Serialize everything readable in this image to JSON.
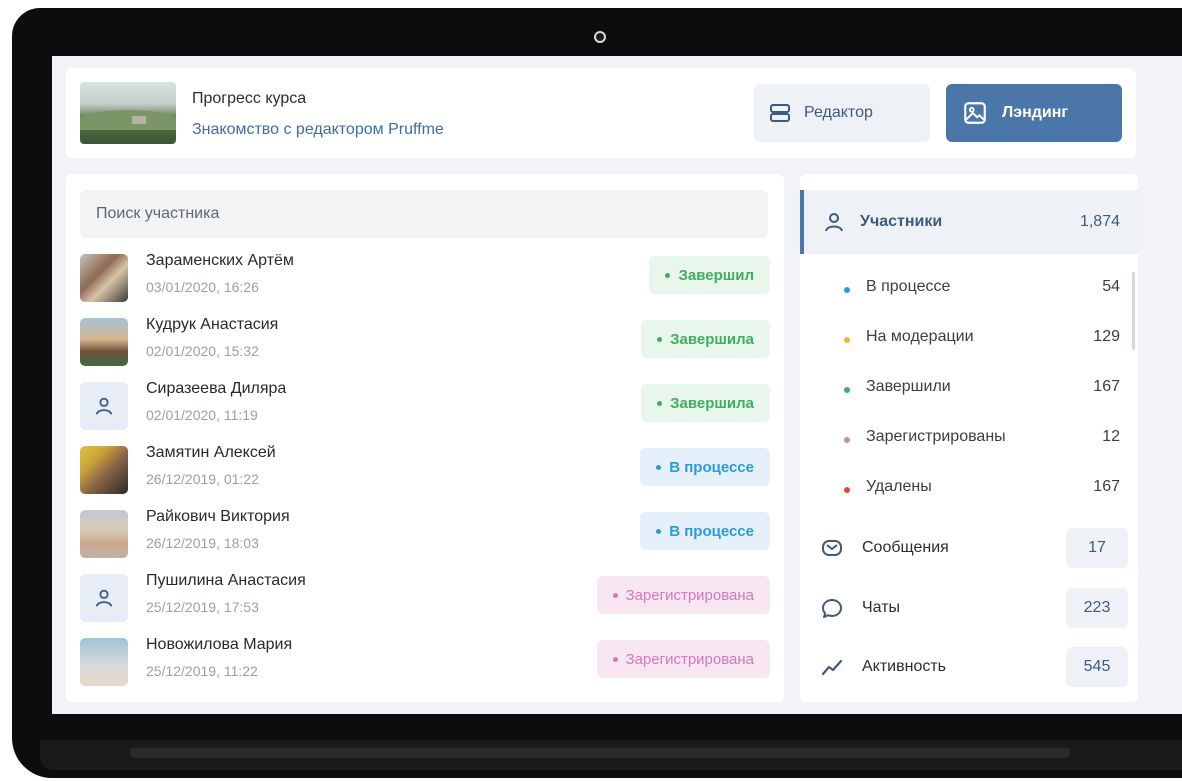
{
  "header": {
    "label": "Прогресс курса",
    "course_name": "Знакомство с редактором Pruffme",
    "editor_button": "Редактор",
    "landing_button": "Лэндинг"
  },
  "search": {
    "placeholder": "Поиск участника"
  },
  "participants_list": [
    {
      "name": "Зараменских Артём",
      "date": "03/01/2020, 16:26",
      "status": "Завершил",
      "status_type": "done",
      "avatar": "photo"
    },
    {
      "name": "Кудрук Анастасия",
      "date": "02/01/2020, 15:32",
      "status": "Завершила",
      "status_type": "done",
      "avatar": "photo"
    },
    {
      "name": "Сиразеева Диляра",
      "date": "02/01/2020, 11:19",
      "status": "Завершила",
      "status_type": "done",
      "avatar": "user-icon"
    },
    {
      "name": "Замятин Алексей",
      "date": "26/12/2019, 01:22",
      "status": "В процессе",
      "status_type": "process",
      "avatar": "photo"
    },
    {
      "name": "Райкович Виктория",
      "date": "26/12/2019, 18:03",
      "status": "В процессе",
      "status_type": "process",
      "avatar": "photo"
    },
    {
      "name": "Пушилина Анастасия",
      "date": "25/12/2019, 17:53",
      "status": "Зарегистрирована",
      "status_type": "registered",
      "avatar": "user-icon"
    },
    {
      "name": "Новожилова Мария",
      "date": "25/12/2019, 11:22",
      "status": "Зарегистрирована",
      "status_type": "registered",
      "avatar": "photo"
    }
  ],
  "sidebar": {
    "participants_label": "Участники",
    "participants_count": "1,874",
    "stats": [
      {
        "label": "В процессе",
        "count": "54",
        "color": "#2a9bd8"
      },
      {
        "label": "На модерации",
        "count": "129",
        "color": "#f0b429"
      },
      {
        "label": "Завершили",
        "count": "167",
        "color": "#3fae5f"
      },
      {
        "label": "Зарегистрированы",
        "count": "12",
        "color": "#c58ab8"
      },
      {
        "label": "Удалены",
        "count": "167",
        "color": "#e0463a"
      }
    ],
    "messages_label": "Сообщения",
    "messages_count": "17",
    "chats_label": "Чаты",
    "chats_count": "223",
    "activity_label": "Активность",
    "activity_count": "545"
  },
  "colors": {
    "accent": "#4a76aa",
    "done": "#3fae5f",
    "process": "#2a9bd8",
    "registered": "#d07ab8"
  }
}
